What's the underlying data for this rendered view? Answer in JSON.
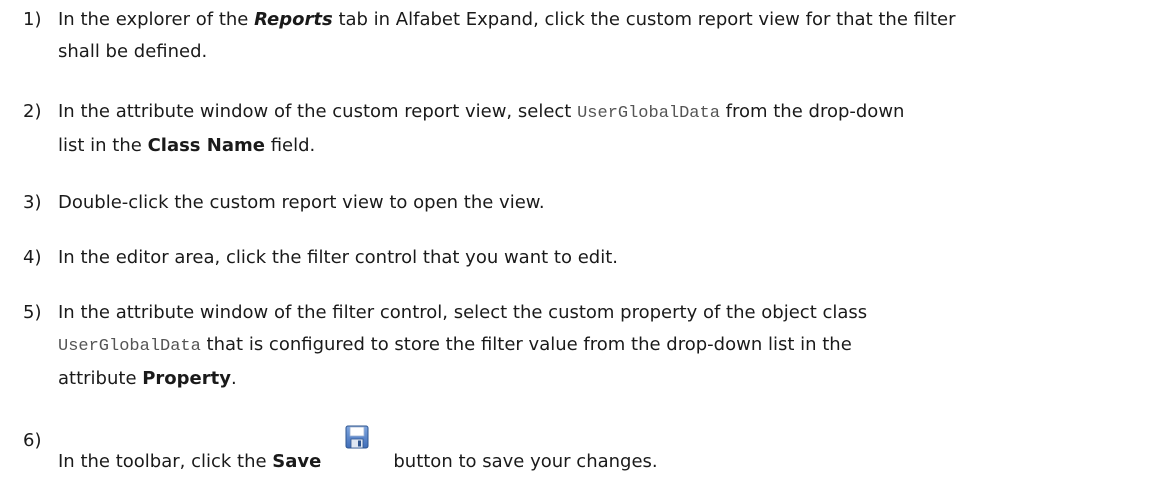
{
  "steps": [
    {
      "num": "1)",
      "parts": [
        "In the explorer of the ",
        "Reports",
        " tab in Alfabet Expand, click the custom report view for that the filter",
        "shall be defined."
      ]
    },
    {
      "num": "2)",
      "parts": [
        "In the attribute window of the custom report view, select ",
        "UserGlobalData",
        " from the drop-down",
        "list in the ",
        "Class Name",
        " field."
      ]
    },
    {
      "num": "3)",
      "parts": [
        "Double-click the custom report view to open the view."
      ]
    },
    {
      "num": "4)",
      "parts": [
        "In the editor area, click the filter control that you want to edit."
      ]
    },
    {
      "num": "5)",
      "parts": [
        "In the attribute window of the filter control, select the custom property of the object class",
        "UserGlobalData",
        " that is configured to store the filter value from the drop-down list in the",
        "attribute ",
        "Property",
        "."
      ]
    },
    {
      "num": "6)",
      "parts": [
        "In the toolbar, click the ",
        "Save",
        "button to save your changes."
      ],
      "icon": "floppy-disk-save-icon"
    }
  ]
}
